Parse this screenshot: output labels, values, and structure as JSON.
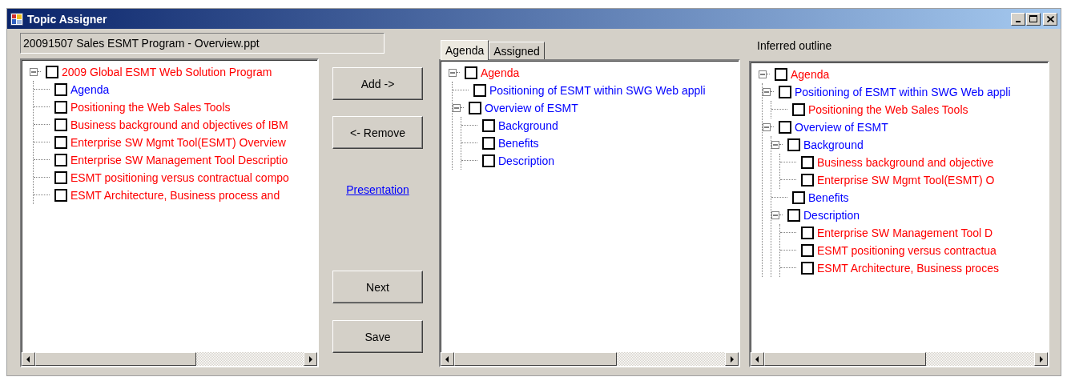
{
  "window": {
    "title": "Topic Assigner"
  },
  "file_field": {
    "value": "20091507 Sales ESMT Program - Overview.ppt"
  },
  "source_tree": [
    {
      "label": "2009 Global ESMT Web Solution Program",
      "color": "#ff0000",
      "checked": false,
      "expanded": true,
      "children": [
        {
          "label": "Agenda",
          "color": "#0000ff",
          "checked": false
        },
        {
          "label": "Positioning the Web Sales Tools",
          "color": "#ff0000",
          "checked": false
        },
        {
          "label": "Business background and objectives of IBM",
          "color": "#ff0000",
          "checked": false
        },
        {
          "label": "Enterprise SW Mgmt Tool(ESMT) Overview",
          "color": "#ff0000",
          "checked": false
        },
        {
          "label": "Enterprise SW Management Tool Descriptio",
          "color": "#ff0000",
          "checked": false
        },
        {
          "label": "ESMT positioning versus contractual compo",
          "color": "#ff0000",
          "checked": false
        },
        {
          "label": "ESMT Architecture, Business process and",
          "color": "#ff0000",
          "checked": false
        }
      ]
    }
  ],
  "actions": [
    {
      "kind": "button",
      "label": "Add ->"
    },
    {
      "kind": "button",
      "label": "<- Remove"
    },
    {
      "kind": "link",
      "label": "Presentation"
    },
    {
      "kind": "button",
      "label": "Next"
    },
    {
      "kind": "button",
      "label": "Save"
    }
  ],
  "agenda_panel": {
    "tabs": [
      {
        "label": "Agenda",
        "selected": true
      },
      {
        "label": "Assigned",
        "selected": false
      }
    ],
    "tree": [
      {
        "label": "Agenda",
        "color": "#ff0000",
        "checked": false,
        "expanded": true,
        "children": [
          {
            "label": "Positioning of ESMT within SWG Web appli",
            "color": "#0000ff",
            "checked": false
          },
          {
            "label": "Overview of ESMT",
            "color": "#0000ff",
            "checked": false,
            "expanded": true,
            "children": [
              {
                "label": "Background",
                "color": "#0000ff",
                "checked": false
              },
              {
                "label": "Benefits",
                "color": "#0000ff",
                "checked": false
              },
              {
                "label": "Description",
                "color": "#0000ff",
                "checked": false
              }
            ]
          }
        ]
      }
    ]
  },
  "outline_panel": {
    "label": "Inferred outline",
    "tree": [
      {
        "label": "Agenda",
        "color": "#ff0000",
        "checked": false,
        "expanded": true,
        "children": [
          {
            "label": "Positioning of ESMT within SWG Web appli",
            "color": "#0000ff",
            "checked": false,
            "expanded": true,
            "children": [
              {
                "label": "Positioning the Web Sales Tools",
                "color": "#ff0000",
                "checked": false
              }
            ]
          },
          {
            "label": "Overview of ESMT",
            "color": "#0000ff",
            "checked": false,
            "expanded": true,
            "children": [
              {
                "label": "Background",
                "color": "#0000ff",
                "checked": false,
                "expanded": true,
                "children": [
                  {
                    "label": "Business background and objective",
                    "color": "#ff0000",
                    "checked": false
                  },
                  {
                    "label": "Enterprise SW Mgmt Tool(ESMT) O",
                    "color": "#ff0000",
                    "checked": false
                  }
                ]
              },
              {
                "label": "Benefits",
                "color": "#0000ff",
                "checked": false
              },
              {
                "label": "Description",
                "color": "#0000ff",
                "checked": false,
                "expanded": true,
                "children": [
                  {
                    "label": "Enterprise SW Management Tool D",
                    "color": "#ff0000",
                    "checked": false
                  },
                  {
                    "label": "ESMT positioning versus contractua",
                    "color": "#ff0000",
                    "checked": false
                  },
                  {
                    "label": "ESMT Architecture, Business proces",
                    "color": "#ff0000",
                    "checked": false
                  }
                ]
              }
            ]
          }
        ]
      }
    ]
  }
}
